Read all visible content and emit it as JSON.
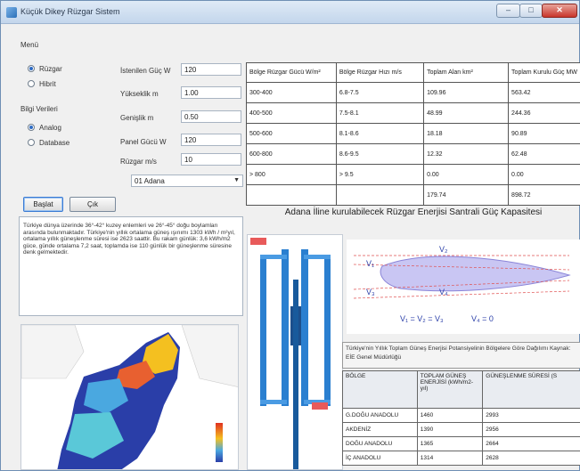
{
  "window": {
    "title": "Küçük Dikey Rüzgar Sistem",
    "controls": {
      "minimize": "–",
      "maximize": "□",
      "close": "✕"
    }
  },
  "menu": {
    "group_label": "Menü",
    "options": [
      {
        "label": "Rüzgar",
        "selected": true
      },
      {
        "label": "Hibrit",
        "selected": false
      }
    ]
  },
  "source": {
    "group_label": "Bilgi Verileri",
    "options": [
      {
        "label": "Analog",
        "selected": true
      },
      {
        "label": "Database",
        "selected": false
      }
    ]
  },
  "inputs": [
    {
      "label": "İstenilen Güç W",
      "value": "120"
    },
    {
      "label": "Yükseklik m",
      "value": "1.00"
    },
    {
      "label": "Genişlik m",
      "value": "0.50"
    },
    {
      "label": "Panel Gücü W",
      "value": "120"
    },
    {
      "label": "Rüzgar m/s",
      "value": "10"
    }
  ],
  "city_select": {
    "value": "01 Adana"
  },
  "buttons": {
    "start": "Başlat",
    "exit": "Çık"
  },
  "wind_table": {
    "headers": [
      "Bölge Rüzgar Gücü W/m²",
      "Bölge Rüzgar Hızı m/s",
      "Toplam Alan km²",
      "Toplam Kurulu Güç MW"
    ],
    "rows": [
      [
        "300-400",
        "6.8-7.5",
        "109.96",
        "563.42"
      ],
      [
        "400-500",
        "7.5-8.1",
        "48.99",
        "244.36"
      ],
      [
        "500-600",
        "8.1-8.6",
        "18.18",
        "90.89"
      ],
      [
        "600-800",
        "8.6-9.5",
        "12.32",
        "62.48"
      ],
      [
        ">   800",
        ">   9.5",
        "0.00",
        "0.00"
      ],
      [
        "",
        "",
        "179.74",
        "898.72"
      ]
    ]
  },
  "caption": "Adana İline kurulabilecek Rüzgar Enerjisi Santrali Güç Kapasitesi",
  "description": "Türkiye dünya üzerinde 36°-42° kuzey enlemleri ve 26°-45° doğu boylamları arasında bulunmaktadır. Türkiye'nin yıllık ortalama güneş ışınımı 1303 kWh / m²yıl, ortalama yıllık güneşlenme süresi ise 2623 saattir. Bu rakam günlük: 3,6 kWh/m2 güce, günde ortalama 7,2 saat, toplamda ise 110 günlük bir güneşlenme süresine denk gelmektedir.",
  "airfoil": {
    "labels": [
      "V₁",
      "V₂",
      "V₃",
      "V₄"
    ],
    "equation_left": "V₁ = V₂ = V₃",
    "equation_right": "V₄ = 0"
  },
  "radiation": {
    "info": "Türkiye'nin Yıllık Toplam Güneş Enerjisi Potansiyelinin Bölgelere Göre Dağılımı Kaynak: EİE Genel Müdürlüğü",
    "headers": [
      "BÖLGE",
      "TOPLAM GÜNEŞ ENERJİSİ (kWh/m2-yıl)",
      "GÜNEŞLENME SÜRESİ (S"
    ],
    "rows": [
      [
        "G.DOĞU ANADOLU",
        "1460",
        "2993"
      ],
      [
        "AKDENİZ",
        "1390",
        "2956"
      ],
      [
        "DOĞU ANADOLU",
        "1365",
        "2664"
      ],
      [
        "İÇ ANADOLU",
        "1314",
        "2628"
      ]
    ]
  },
  "colors": {
    "accent": "#2d6bc4",
    "turbine": "#2a7fd0",
    "map_low": "#2a3ea8",
    "map_high": "#f4c020"
  },
  "icons": [
    "app-icon",
    "radio-icon",
    "dropdown-arrow-icon"
  ]
}
